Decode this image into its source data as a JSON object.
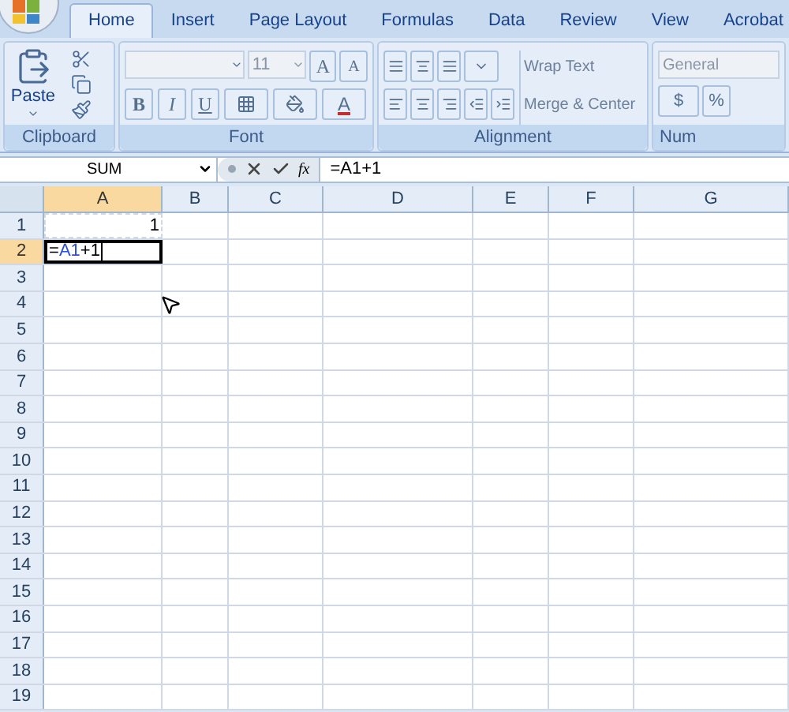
{
  "tabs": [
    {
      "label": "Home",
      "selected": true
    },
    {
      "label": "Insert",
      "selected": false
    },
    {
      "label": "Page Layout",
      "selected": false
    },
    {
      "label": "Formulas",
      "selected": false
    },
    {
      "label": "Data",
      "selected": false
    },
    {
      "label": "Review",
      "selected": false
    },
    {
      "label": "View",
      "selected": false
    },
    {
      "label": "Acrobat",
      "selected": false
    }
  ],
  "clipboard": {
    "paste": "Paste",
    "label": "Clipboard"
  },
  "font": {
    "size": "11",
    "grow": "A",
    "shrink": "A",
    "bold": "B",
    "italic": "I",
    "underline": "U",
    "font_color_letter": "A",
    "label": "Font"
  },
  "alignment": {
    "wrap": "Wrap Text",
    "merge": "Merge & Center",
    "label": "Alignment"
  },
  "number": {
    "format": "General",
    "currency": "$",
    "percent": "%",
    "label": "Num"
  },
  "formula_bar": {
    "name_box": "SUM",
    "fx": "fx",
    "formula": "=A1+1"
  },
  "columns": [
    {
      "label": "A",
      "selected": true
    },
    {
      "label": "B",
      "selected": false
    },
    {
      "label": "C",
      "selected": false
    },
    {
      "label": "D",
      "selected": false
    },
    {
      "label": "E",
      "selected": false
    },
    {
      "label": "F",
      "selected": false
    },
    {
      "label": "G",
      "selected": false
    }
  ],
  "rows": [
    {
      "label": "1",
      "selected": false,
      "cells": [
        {
          "kind": "number",
          "text": "1"
        }
      ]
    },
    {
      "label": "2",
      "selected": true,
      "cells": [
        {
          "kind": "formula",
          "editing": true,
          "parts": [
            {
              "kind": "plain",
              "text": "="
            },
            {
              "kind": "ref",
              "text": "A1"
            },
            {
              "kind": "plain",
              "text": "+1"
            }
          ]
        }
      ]
    },
    {
      "label": "3",
      "selected": false
    },
    {
      "label": "4",
      "selected": false
    },
    {
      "label": "5",
      "selected": false
    },
    {
      "label": "6",
      "selected": false
    },
    {
      "label": "7",
      "selected": false
    },
    {
      "label": "8",
      "selected": false
    },
    {
      "label": "9",
      "selected": false
    },
    {
      "label": "10",
      "selected": false
    },
    {
      "label": "11",
      "selected": false
    },
    {
      "label": "12",
      "selected": false
    },
    {
      "label": "13",
      "selected": false
    },
    {
      "label": "14",
      "selected": false
    },
    {
      "label": "15",
      "selected": false
    },
    {
      "label": "16",
      "selected": false
    },
    {
      "label": "17",
      "selected": false
    },
    {
      "label": "18",
      "selected": false
    },
    {
      "label": "19",
      "selected": false
    }
  ]
}
